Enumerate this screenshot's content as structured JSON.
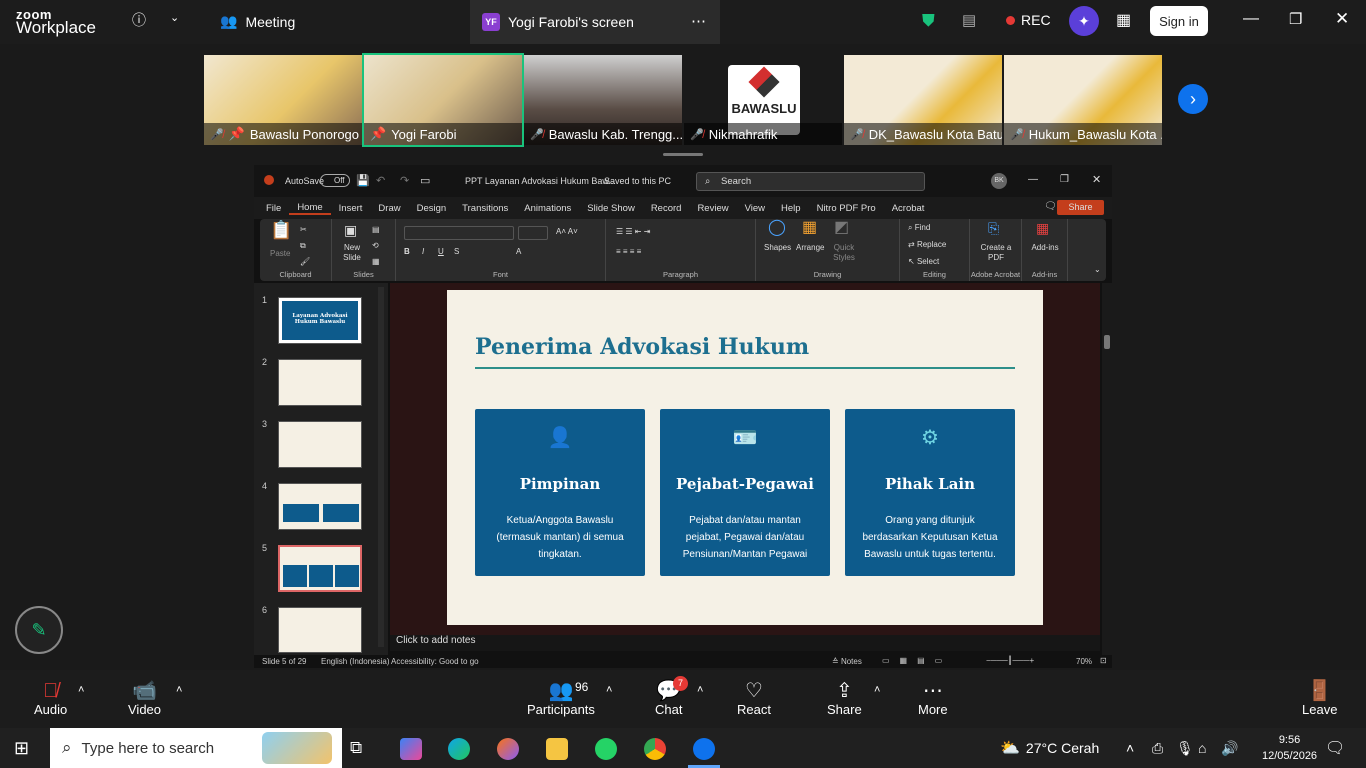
{
  "zoom": {
    "logo_top": "zoom",
    "logo_bottom": "Workplace",
    "meeting_label": "Meeting",
    "screen_tab_initials": "YF",
    "screen_tab_label": "Yogi Farobi's screen",
    "rec_label": "REC",
    "signin_label": "Sign in"
  },
  "participants": [
    {
      "name": "Bawaslu Ponorogo"
    },
    {
      "name": "Yogi Farobi"
    },
    {
      "name": "Bawaslu Kab. Trengg..."
    },
    {
      "name": "Nikmahrafik"
    },
    {
      "name": "DK_Bawaslu Kota Batu"
    },
    {
      "name": "Hukum_Bawaslu Kota ..."
    }
  ],
  "logo_tile_text": "BAWASLU",
  "ppt": {
    "autosave": "AutoSave",
    "autosave_state": "Off",
    "doc_title": "PPT Layanan Advokasi Hukum Baw...",
    "saved": "Saved to this PC",
    "search": "Search",
    "user_initials": "BK",
    "share": "Share",
    "menu": [
      "File",
      "Home",
      "Insert",
      "Draw",
      "Design",
      "Transitions",
      "Animations",
      "Slide Show",
      "Record",
      "Review",
      "View",
      "Help",
      "Nitro PDF Pro",
      "Acrobat"
    ],
    "groups": {
      "clipboard": "Clipboard",
      "slides": "Slides",
      "font": "Font",
      "paragraph": "Paragraph",
      "drawing": "Drawing",
      "editing": "Editing",
      "adobe": "Adobe Acrobat",
      "addins": "Add-ins"
    },
    "buttons": {
      "paste": "Paste",
      "new_slide": "New Slide",
      "shapes": "Shapes",
      "arrange": "Arrange",
      "quick_styles": "Quick Styles",
      "find": "Find",
      "replace": "Replace",
      "select": "Select",
      "create_pdf": "Create a PDF",
      "addins": "Add-ins"
    },
    "thumb_numbers": [
      "1",
      "2",
      "3",
      "4",
      "5",
      "6"
    ],
    "thumb1_title": "Layanan Advokasi Hukum Bawaslu",
    "notes": "Click to add notes",
    "status": {
      "slide": "Slide 5 of 29",
      "lang": "English (Indonesia)",
      "access": "Accessibility: Good to go",
      "notes": "Notes",
      "zoom": "70%"
    }
  },
  "slide": {
    "title": "Penerima Advokasi Hukum",
    "cards": [
      {
        "title": "Pimpinan",
        "desc": "Ketua/Anggota Bawaslu (termasuk mantan) di semua tingkatan."
      },
      {
        "title": "Pejabat-Pegawai",
        "desc": "Pejabat dan/atau mantan pejabat, Pegawai dan/atau Pensiunan/Mantan Pegawai"
      },
      {
        "title": "Pihak Lain",
        "desc": "Orang yang ditunjuk berdasarkan Keputusan Ketua Bawaslu untuk tugas tertentu."
      }
    ]
  },
  "controls": {
    "audio": "Audio",
    "video": "Video",
    "participants": "Participants",
    "participants_count": "96",
    "chat": "Chat",
    "chat_badge": "7",
    "react": "React",
    "share": "Share",
    "more": "More",
    "leave": "Leave"
  },
  "taskbar": {
    "search_placeholder": "Type here to search",
    "weather": "27°C Cerah",
    "time": "9:56",
    "date": "12/05/2026"
  },
  "colors": {
    "slide_card": "#0d5b8c",
    "slide_title": "#1d6f8f",
    "zoom_blue": "#0e72ed",
    "rec_red": "#e53935"
  }
}
